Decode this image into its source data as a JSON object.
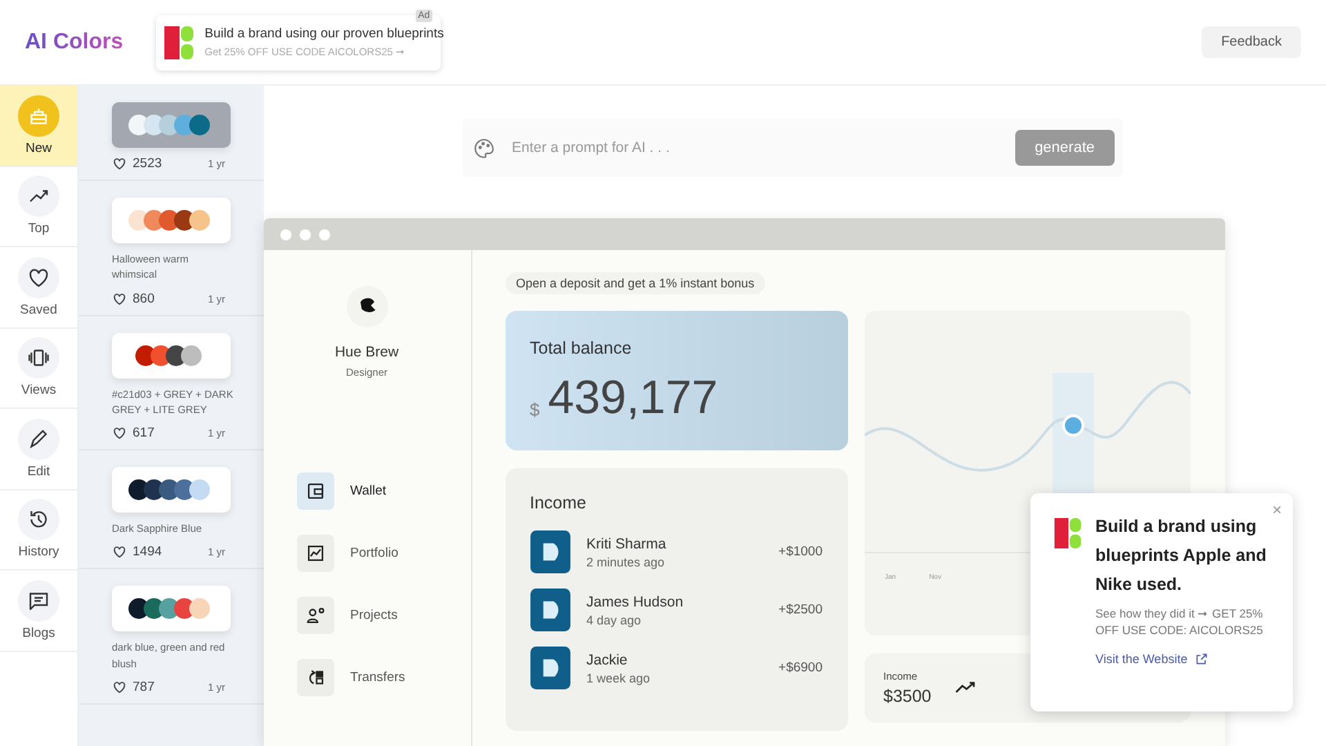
{
  "header": {
    "logo": "AI Colors",
    "ad": {
      "badge": "Ad",
      "title": "Build a brand using our proven blueprints",
      "subtitle": "Get 25% OFF USE CODE AICOLORS25 ➞"
    },
    "feedback": "Feedback"
  },
  "nav": [
    {
      "label": "New",
      "selected": true
    },
    {
      "label": "Top",
      "selected": false
    },
    {
      "label": "Saved",
      "selected": false
    },
    {
      "label": "Views",
      "selected": false
    },
    {
      "label": "Edit",
      "selected": false
    },
    {
      "label": "History",
      "selected": false
    },
    {
      "label": "Blogs",
      "selected": false
    }
  ],
  "palettes": [
    {
      "selected": true,
      "swatches": [
        {
          "color": "#f2f6f9"
        },
        {
          "color": "#d6e6f0"
        },
        {
          "color": "#b5cfdd"
        },
        {
          "color": "#5eaede"
        },
        {
          "color": "#0d6b8a"
        }
      ],
      "likes": "2523",
      "age": "1 yr"
    },
    {
      "selected": false,
      "name": "Halloween warm whimsical",
      "swatches": [
        {
          "color": "#fbe3d2"
        },
        {
          "color": "#f08a5a"
        },
        {
          "color": "#e05a2e"
        },
        {
          "color": "#9a3a12"
        },
        {
          "color": "#f6c48a"
        }
      ],
      "likes": "860",
      "age": "1 yr"
    },
    {
      "selected": false,
      "name": "#c21d03 + GREY + DARK GREY + LITE GREY",
      "swatches": [
        {
          "color": "#c21d03"
        },
        {
          "color": "#f0502e"
        },
        {
          "color": "#444444"
        },
        {
          "color": "#bdbdbd"
        }
      ],
      "likes": "617",
      "age": "1 yr"
    },
    {
      "selected": false,
      "name": "Dark Sapphire Blue",
      "swatches": [
        {
          "color": "#0f1c2e"
        },
        {
          "color": "#1f3350"
        },
        {
          "color": "#3a5a80"
        },
        {
          "color": "#4c6f9c"
        },
        {
          "color": "#c4dcf3"
        }
      ],
      "likes": "1494",
      "age": "1 yr"
    },
    {
      "selected": false,
      "name": "dark blue, green and red blush",
      "swatches": [
        {
          "color": "#0d1b2a"
        },
        {
          "color": "#1b6b5c"
        },
        {
          "color": "#56a1a0"
        },
        {
          "color": "#e8433f"
        },
        {
          "color": "#f9d5b8"
        }
      ],
      "likes": "787",
      "age": "1 yr"
    }
  ],
  "prompt": {
    "placeholder": "Enter a prompt for AI . . .",
    "button": "generate"
  },
  "mockup": {
    "profile": {
      "name": "Hue Brew",
      "role": "Designer"
    },
    "menu": [
      {
        "label": "Wallet",
        "selected": true
      },
      {
        "label": "Portfolio",
        "selected": false
      },
      {
        "label": "Projects",
        "selected": false
      },
      {
        "label": "Transfers",
        "selected": false
      }
    ],
    "promo": "Open a deposit and get a 1% instant bonus",
    "balance": {
      "title": "Total balance",
      "currency": "$",
      "amount": "439,177"
    },
    "income": {
      "title": "Income",
      "rows": [
        {
          "name": "Kriti Sharma",
          "time": "2 minutes ago",
          "amount": "+$1000"
        },
        {
          "name": "James Hudson",
          "time": "4 day ago",
          "amount": "+$2500"
        },
        {
          "name": "Jackie",
          "time": "1 week ago",
          "amount": "+$6900"
        }
      ]
    },
    "chart": {
      "labels": [
        "Jan",
        "Nov"
      ]
    },
    "summary": {
      "label": "Income",
      "value": "$3500"
    }
  },
  "popup": {
    "title": "Build a brand using blueprints Apple and Nike used.",
    "text": "See how they did it ➞ GET 25% OFF USE CODE: AICOLORS25",
    "link": "Visit the Website",
    "close": "×"
  }
}
